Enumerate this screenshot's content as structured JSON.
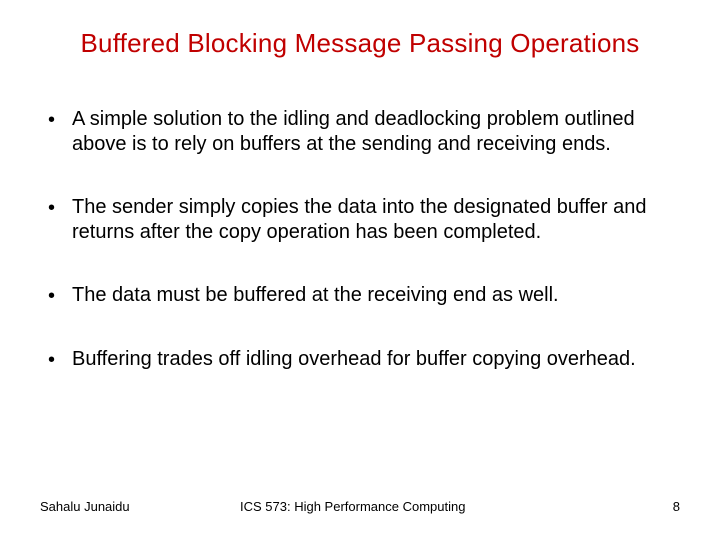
{
  "title": "Buffered Blocking Message Passing Operations",
  "bullets": [
    "A simple solution to the idling and deadlocking problem outlined above is to rely on buffers at the sending and receiving ends.",
    "The sender simply copies the data into the designated buffer and returns after the copy operation has been completed.",
    "The data must be buffered at the receiving end as well.",
    "Buffering trades off idling overhead for buffer copying overhead."
  ],
  "footer": {
    "author": "Sahalu Junaidu",
    "course": "ICS 573: High Performance Computing",
    "page": "8"
  }
}
